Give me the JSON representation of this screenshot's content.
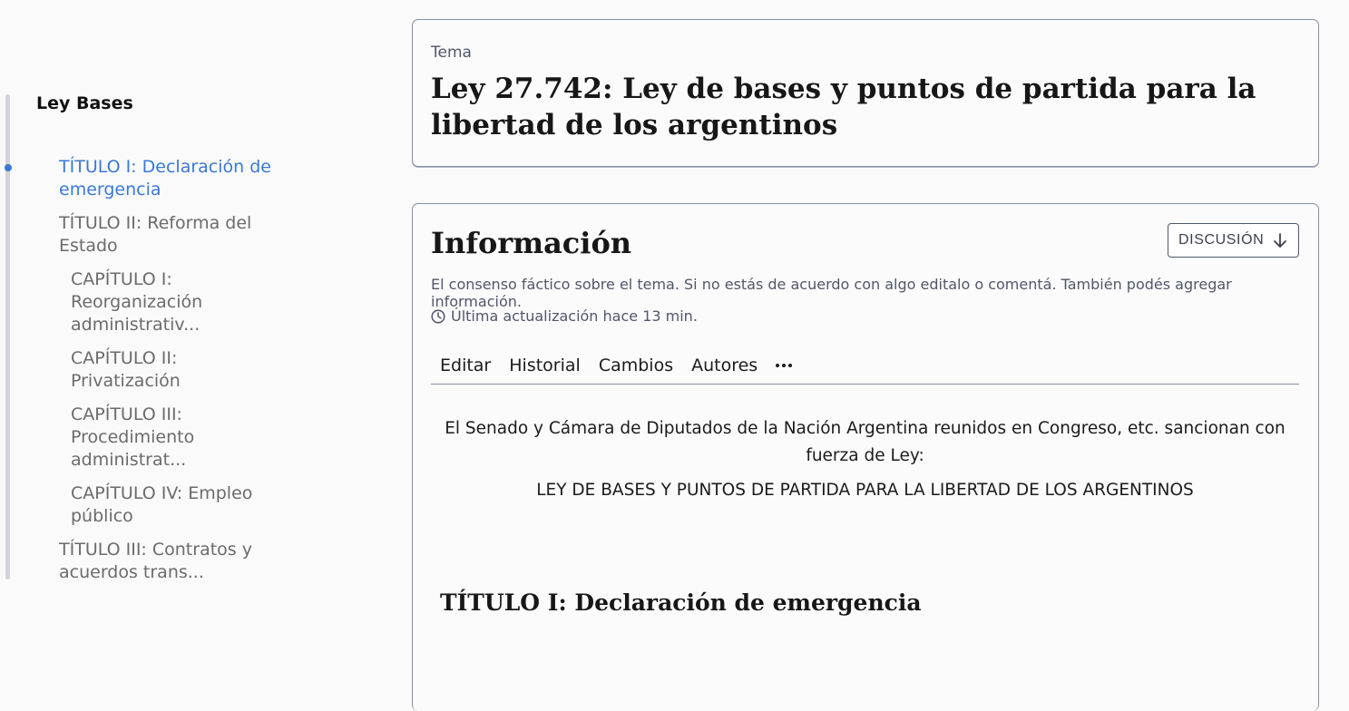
{
  "toc": {
    "title": "Ley Bases",
    "items": [
      {
        "label": "TÍTULO I: Declaración de emergencia",
        "level": 1,
        "active": true
      },
      {
        "label": "TÍTULO II: Reforma del Estado",
        "level": 1,
        "active": false
      },
      {
        "label": "CAPÍTULO I: Reorganización administrativ...",
        "level": 2,
        "active": false
      },
      {
        "label": "CAPÍTULO II: Privatización",
        "level": 2,
        "active": false
      },
      {
        "label": "CAPÍTULO III: Procedimiento administrat...",
        "level": 2,
        "active": false
      },
      {
        "label": "CAPÍTULO IV: Empleo público",
        "level": 2,
        "active": false
      },
      {
        "label": "TÍTULO III: Contratos y acuerdos trans...",
        "level": 1,
        "active": false
      }
    ],
    "accent_color": "#3a78d6"
  },
  "topic": {
    "eyebrow": "Tema",
    "title": "Ley 27.742: Ley de bases y puntos de partida para la libertad de los argentinos"
  },
  "info": {
    "title": "Información",
    "discussion_label": "DISCUSIÓN",
    "description": "El consenso fáctico sobre el tema. Si no estás de acuerdo con algo editalo o comentá. También podés agregar información.",
    "updated": "Última actualización hace 13 min.",
    "tabs": [
      "Editar",
      "Historial",
      "Cambios",
      "Autores"
    ],
    "more_icon": "ellipsis-icon"
  },
  "document": {
    "intro": "El Senado y Cámara de Diputados de la Nación Argentina reunidos en Congreso, etc. sancionan con fuerza de Ley:",
    "heading": "LEY DE BASES Y PUNTOS DE PARTIDA PARA LA LIBERTAD DE LOS ARGENTINOS",
    "section_title": "TÍTULO I: Declaración de emergencia"
  }
}
